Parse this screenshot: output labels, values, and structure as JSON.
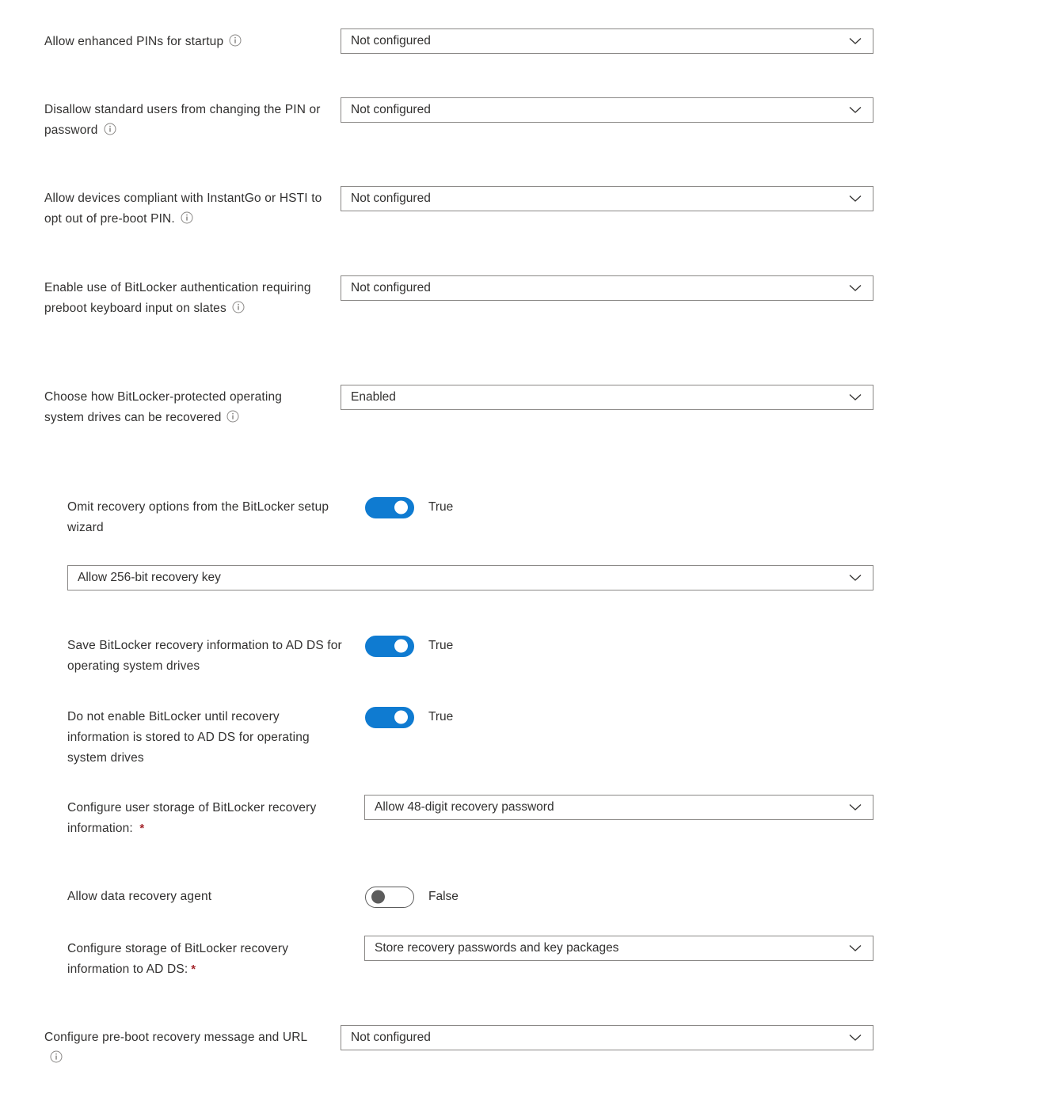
{
  "page": {
    "kind": "settings-form",
    "accent_color": "#0f7bd1",
    "required_marker_color": "#a4262c",
    "text_color": "#323130",
    "border_color": "#8a8886",
    "required_marker": "*"
  },
  "settings": [
    {
      "id": "allow-enhanced-pins-for-startup",
      "label": "Allow enhanced PINs for startup",
      "has_info_icon": true,
      "control": "dropdown",
      "value": "Not configured",
      "indent": 0
    },
    {
      "id": "disallow-standard-users-from-changing-the-pin-or-password",
      "label": "Disallow standard users from changing the PIN or password",
      "has_info_icon": true,
      "control": "dropdown",
      "value": "Not configured",
      "indent": 0
    },
    {
      "id": "allow-devices-compliant-with-instantgo-or-hsti-to-opt-out-of-pre-boot-pin",
      "label": "Allow devices compliant with InstantGo or HSTI to opt out of pre-boot PIN.",
      "has_info_icon": true,
      "control": "dropdown",
      "value": "Not configured",
      "indent": 0
    },
    {
      "id": "enable-use-of-bitlocker-authentication-requiring-preboot-keyboard-input-on-slates",
      "label": "Enable use of BitLocker authentication requiring preboot keyboard input on slates",
      "has_info_icon": true,
      "control": "dropdown",
      "value": "Not configured",
      "indent": 0
    },
    {
      "id": "choose-how-bitlocker-protected-operating-system-drives-can-be-recovered",
      "label": "Choose how BitLocker-protected operating system drives can be recovered",
      "has_info_icon": true,
      "control": "dropdown",
      "value": "Enabled",
      "indent": 0
    },
    {
      "id": "omit-recovery-options-from-the-bitlocker-setup-wizard",
      "label": "Omit recovery options from the BitLocker setup wizard",
      "has_info_icon": false,
      "control": "toggle",
      "value": "True",
      "toggle_on": true,
      "indent": 1
    },
    {
      "id": "allow-256-bit-recovery-key",
      "label": "",
      "has_info_icon": false,
      "control": "dropdown",
      "value": "Allow 256-bit recovery key",
      "indent": 1
    },
    {
      "id": "save-bitlocker-recovery-information-to-ad-ds-for-operating-system-drives",
      "label": "Save BitLocker recovery information to AD DS for operating system drives",
      "has_info_icon": false,
      "control": "toggle",
      "value": "True",
      "toggle_on": true,
      "indent": 1
    },
    {
      "id": "do-not-enable-bitlocker-until-recovery-information-is-stored-to-ad-ds-for-operating-system-drives",
      "label": "Do not enable BitLocker until recovery information is stored to AD DS for operating system drives",
      "has_info_icon": false,
      "control": "toggle",
      "value": "True",
      "toggle_on": true,
      "indent": 1
    },
    {
      "id": "configure-user-storage-of-bitlocker-recovery-information",
      "label": "Configure user storage of BitLocker recovery information: ",
      "required": true,
      "has_info_icon": false,
      "control": "dropdown",
      "value": "Allow 48-digit recovery password",
      "indent": 1
    },
    {
      "id": "allow-data-recovery-agent",
      "label": "Allow data recovery agent",
      "has_info_icon": false,
      "control": "toggle",
      "value": "False",
      "toggle_on": false,
      "indent": 1
    },
    {
      "id": "configure-storage-of-bitlocker-recovery-information-to-ad-ds",
      "label": "Configure storage of BitLocker recovery information to AD DS:",
      "required": true,
      "has_info_icon": false,
      "control": "dropdown",
      "value": "Store recovery passwords and key packages",
      "indent": 1
    },
    {
      "id": "configure-pre-boot-recovery-message-and-url",
      "label": "Configure pre-boot recovery message and URL",
      "has_info_icon": true,
      "control": "dropdown",
      "value": "Not configured",
      "indent": 0
    }
  ]
}
